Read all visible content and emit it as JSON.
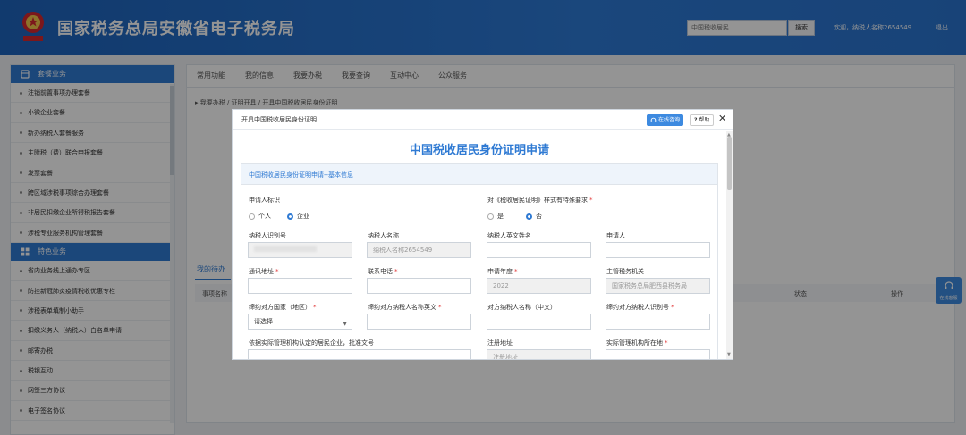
{
  "header": {
    "title": "国家税务总局安徽省电子税务局",
    "search_placeholder": "中国税收居民",
    "search_button": "搜索",
    "welcome": "欢迎，纳税人名称2654549",
    "separator": "|",
    "logout": "退出"
  },
  "sidebar": {
    "group1": "套餐业务",
    "group1_items": [
      "注销前置事项办理套餐",
      "小微企业套餐",
      "新办纳税人套餐服务",
      "主附税（费）联合申报套餐",
      "发票套餐",
      "跨区域涉税事项综合办理套餐",
      "非居民扣缴企业所得税报告套餐",
      "涉税专业服务机构管理套餐"
    ],
    "group2": "特色业务",
    "group2_items": [
      "省内业务线上通办专区",
      "防控新冠肺炎疫情税收优惠专栏",
      "涉税表单填制小助手",
      "扣缴义务人（纳税人）白名单申请",
      "邮寄办税",
      "税银互动",
      "网签三方协议",
      "电子签名协议"
    ]
  },
  "main": {
    "tabs": [
      "常用功能",
      "我的信息",
      "我要办税",
      "我要查询",
      "互动中心",
      "公众服务"
    ],
    "breadcrumb": "我要办税 / 证明开具 / 开具中国税收居民身份证明",
    "mytasks_tab": "我的待办",
    "columns": [
      "事项名称",
      "状态",
      "操作"
    ]
  },
  "floater": {
    "label": "在线客服"
  },
  "modal": {
    "bar_title": "开具中国税收居民身份证明",
    "online_button": "在线咨询",
    "help_button": "帮助",
    "help_icon": "?",
    "close": "✕",
    "form_title": "中国税收居民身份证明申请",
    "section_title": "中国税收居民身份证明申请--基本信息",
    "applicant_type_label": "申请人标识",
    "applicant_type_options": [
      "个人",
      "企业"
    ],
    "applicant_type_selected": "企业",
    "special_req_label": "对《税收居民证明》样式有特殊要求",
    "special_req_options": [
      "是",
      "否"
    ],
    "special_req_selected": "否",
    "required_mark": "*",
    "fields": {
      "tax_id_label": "纳税人识别号",
      "tax_name_label": "纳税人名称",
      "tax_name_value": "纳税人名称2654549",
      "en_name_label": "纳税人英文姓名",
      "applicant_label": "申请人",
      "address_label": "通讯地址",
      "phone_label": "联系电话",
      "year_label": "申请年度",
      "year_value": "2022",
      "authority_label": "主管税务机关",
      "authority_value": "国家税务总局肥西县税务局",
      "country_label": "缔约对方国家（地区）",
      "country_value": "请选择",
      "counter_en_label": "缔约对方纳税人名称英文",
      "counter_cn_label": "对方纳税人名称（中文）",
      "counter_id_label": "缔约对方纳税人识别号",
      "resident_doc_label": "依据实际管理机构认定的居民企业，批准文号",
      "reg_addr_label": "注册地址",
      "reg_addr_placeholder": "注册地址",
      "mgmt_loc_label": "实际管理机构所在地"
    }
  }
}
